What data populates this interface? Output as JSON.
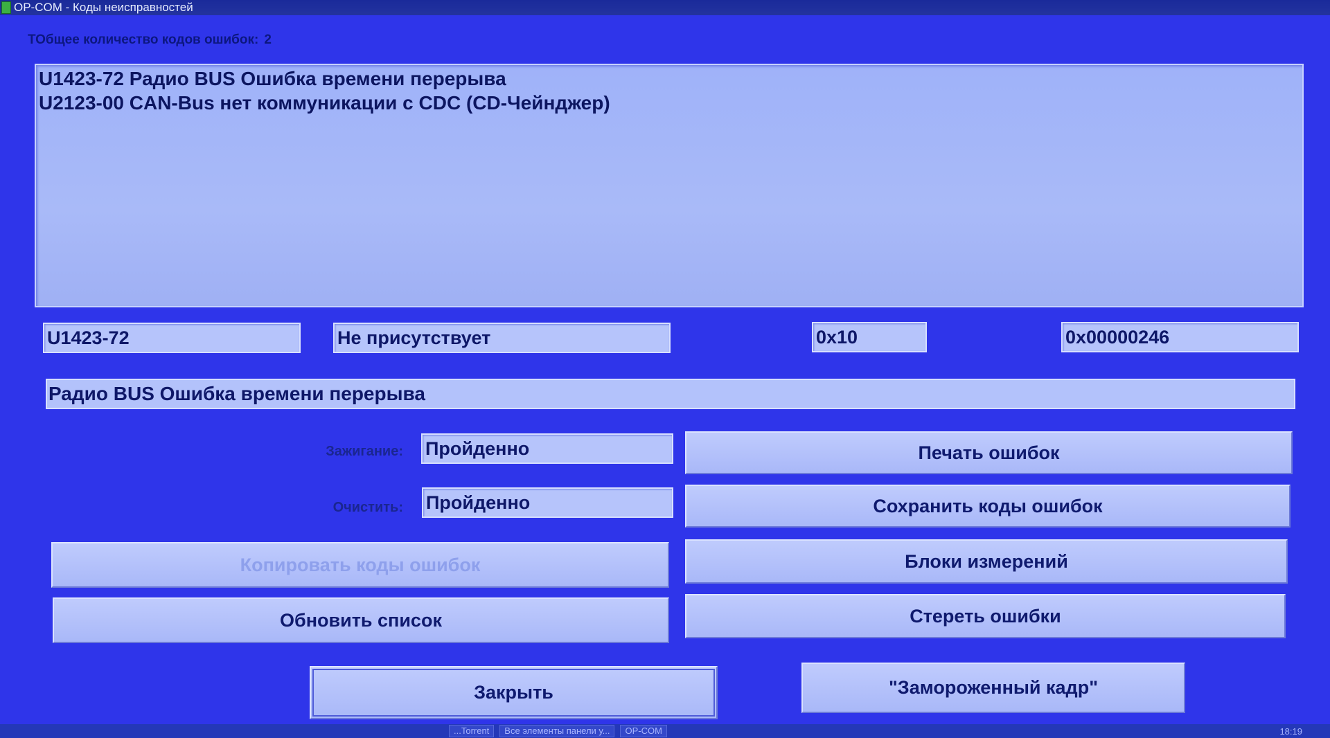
{
  "window": {
    "title": "OP-COM - Коды неисправностей",
    "icon": "app-icon"
  },
  "summary": {
    "label": "ТОбщее количество кодов ошибок:",
    "count": "2"
  },
  "dtc_list": [
    "U1423-72 Радио BUS Ошибка времени перерыва",
    "U2123-00 CAN-Bus нет коммуникации с CDC (CD-Чейнджер)"
  ],
  "detail": {
    "code": "U1423-72",
    "status": "Не присутствует",
    "hex1": "0x10",
    "hex2": "0x00000246",
    "description": "Радио BUS Ошибка времени перерыва",
    "ignition_label": "Зажигание:",
    "ignition_value": "Пройденно",
    "clear_label": "Очистить:",
    "clear_value": "Пройденно"
  },
  "buttons": {
    "print": "Печать ошибок",
    "save": "Сохранить коды ошибок",
    "copy": "Копировать коды ошибок",
    "measure": "Блоки измерений",
    "refresh": "Обновить список",
    "erase": "Стереть ошибки",
    "close": "Закрыть",
    "freeze": "\"Замороженный кадр\""
  },
  "taskbar": {
    "items": [
      "...Torrent",
      "Все элементы панели у...",
      "OP-COM"
    ],
    "clock": "18:19"
  },
  "colors": {
    "background": "#2f35ea",
    "panel": "#a9baf8",
    "text": "#0e1768"
  }
}
